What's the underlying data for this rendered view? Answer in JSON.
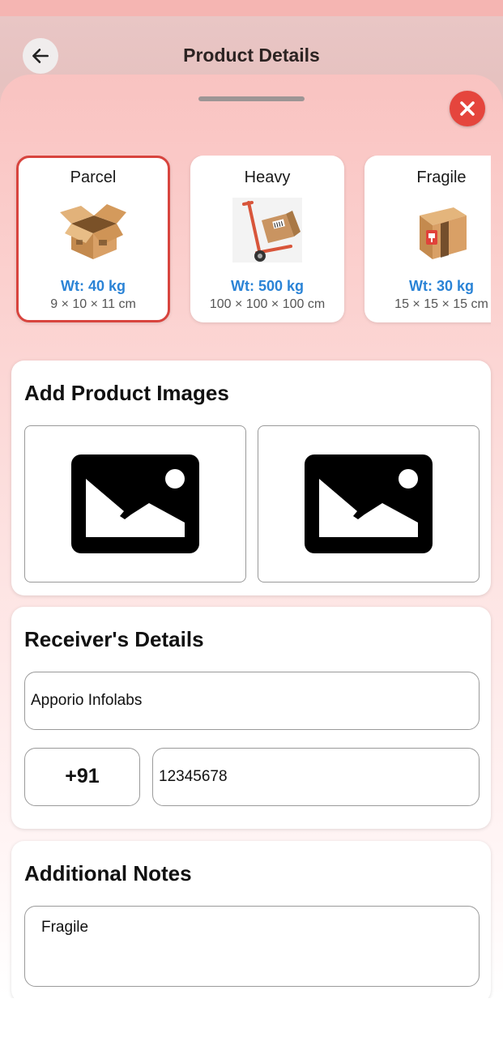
{
  "header": {
    "title": "Product Details",
    "back_icon": "arrow-left-icon"
  },
  "sheet": {
    "close_icon": "close-x-icon",
    "close_color": "#e5453d"
  },
  "packages": [
    {
      "name": "Parcel",
      "weight": "Wt: 40 kg",
      "dims": "9 × 10 × 11 cm",
      "icon": "open-box-icon",
      "selected": true
    },
    {
      "name": "Heavy",
      "weight": "Wt: 500 kg",
      "dims": "100 × 100 × 100 cm",
      "icon": "hand-truck-icon",
      "selected": false
    },
    {
      "name": "Fragile",
      "weight": "Wt: 30 kg",
      "dims": "15 × 15 × 15 cm",
      "icon": "fragile-box-icon",
      "selected": false
    }
  ],
  "product_images": {
    "title": "Add Product Images",
    "slots": [
      {
        "icon": "image-placeholder-icon"
      },
      {
        "icon": "image-placeholder-icon"
      }
    ]
  },
  "receiver": {
    "title": "Receiver's Details",
    "name_value": "Apporio Infolabs",
    "country_code": "+91",
    "phone_value": "12345678"
  },
  "notes": {
    "title": "Additional Notes",
    "value": "Fragile"
  },
  "colors": {
    "accent_blue": "#2a83d6",
    "selected_border": "#d8443e"
  }
}
